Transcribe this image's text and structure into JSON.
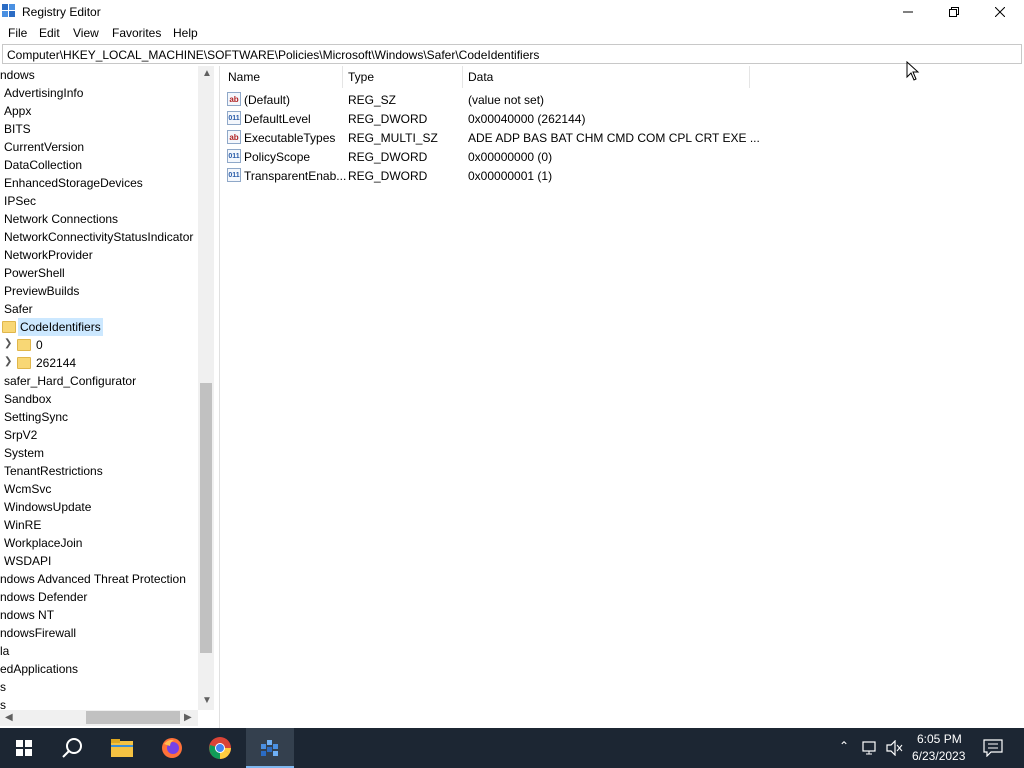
{
  "window": {
    "title": "Registry Editor"
  },
  "menu": [
    "File",
    "Edit",
    "View",
    "Favorites",
    "Help"
  ],
  "address": "Computer\\HKEY_LOCAL_MACHINE\\SOFTWARE\\Policies\\Microsoft\\Windows\\Safer\\CodeIdentifiers",
  "tree": {
    "items": [
      "ndows",
      "AdvertisingInfo",
      "Appx",
      "BITS",
      "CurrentVersion",
      "DataCollection",
      "EnhancedStorageDevices",
      "IPSec",
      "Network Connections",
      "NetworkConnectivityStatusIndicator",
      "NetworkProvider",
      "PowerShell",
      "PreviewBuilds",
      "Safer",
      "CodeIdentifiers",
      "0",
      "262144",
      "safer_Hard_Configurator",
      "Sandbox",
      "SettingSync",
      "SrpV2",
      "System",
      "TenantRestrictions",
      "WcmSvc",
      "WindowsUpdate",
      "WinRE",
      "WorkplaceJoin",
      "WSDAPI",
      "ndows Advanced Threat Protection",
      "ndows Defender",
      "ndows NT",
      "ndowsFirewall",
      "la",
      "edApplications",
      "s",
      "s"
    ],
    "selected": "CodeIdentifiers"
  },
  "columns": {
    "name": "Name",
    "type": "Type",
    "data": "Data"
  },
  "values": [
    {
      "icon": "string-value-icon",
      "name": "(Default)",
      "type": "REG_SZ",
      "data": "(value not set)"
    },
    {
      "icon": "binary-value-icon",
      "name": "DefaultLevel",
      "type": "REG_DWORD",
      "data": "0x00040000 (262144)"
    },
    {
      "icon": "string-value-icon",
      "name": "ExecutableTypes",
      "type": "REG_MULTI_SZ",
      "data": "ADE ADP BAS BAT CHM CMD COM CPL CRT EXE ..."
    },
    {
      "icon": "binary-value-icon",
      "name": "PolicyScope",
      "type": "REG_DWORD",
      "data": "0x00000000 (0)"
    },
    {
      "icon": "binary-value-icon",
      "name": "TransparentEnab...",
      "type": "REG_DWORD",
      "data": "0x00000001 (1)"
    }
  ],
  "icon_text": {
    "string": "ab",
    "binary": "011"
  },
  "taskbar": {
    "apps": [
      "start-icon",
      "search-icon",
      "file-explorer-icon",
      "firefox-icon",
      "chrome-icon",
      "registry-editor-icon"
    ],
    "time": "6:05 PM",
    "date": "6/23/2023"
  },
  "colors": {
    "taskbar": "#1c2633",
    "selection": "#cce8ff",
    "folder": "#f8d775"
  }
}
